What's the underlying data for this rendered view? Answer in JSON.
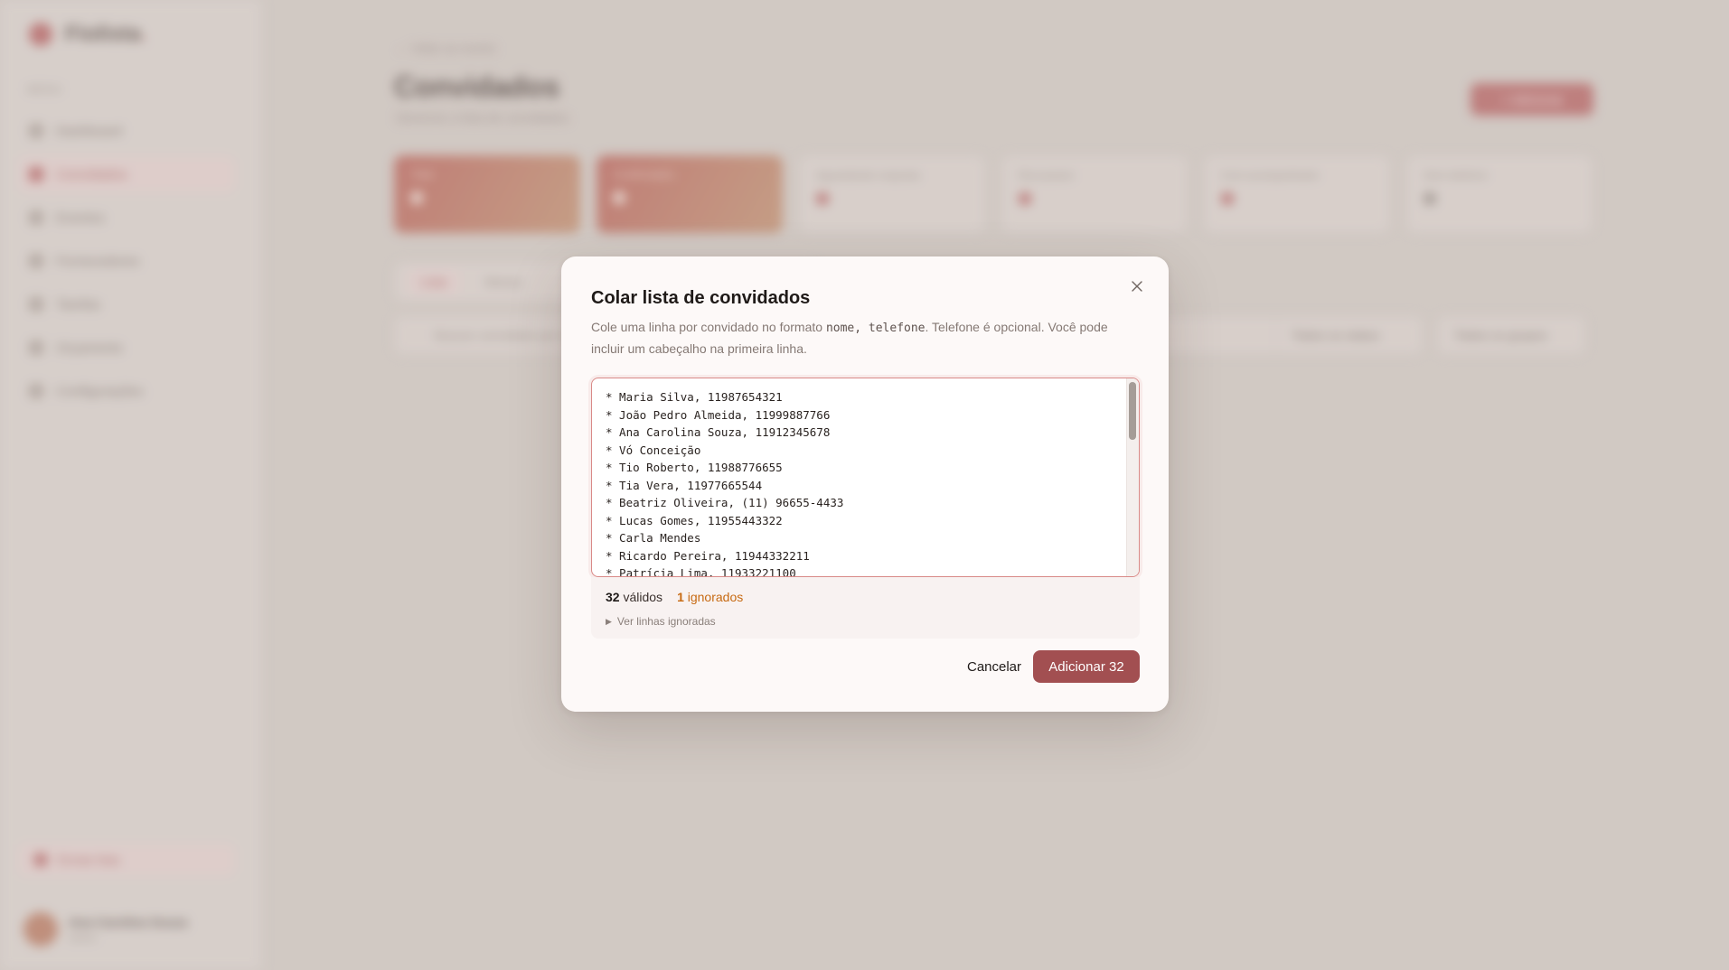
{
  "sidebar": {
    "brand": "Fiolista",
    "section_label": "MENU",
    "items": [
      {
        "label": "Dashboard"
      },
      {
        "label": "Convidados"
      },
      {
        "label": "Eventos"
      },
      {
        "label": "Fornecedores"
      },
      {
        "label": "Tarefas"
      },
      {
        "label": "Orçamento"
      },
      {
        "label": "Configurações"
      }
    ],
    "cta": "Enviar lista",
    "profile": {
      "name": "Ana Carolina Souza",
      "role": "Admin"
    }
  },
  "page": {
    "back": "← Voltar ao evento",
    "title": "Convidados",
    "subtitle": "Gerencie a lista de convidados",
    "primary_action": "+ Adicionar",
    "stats": [
      {
        "label": "Total"
      },
      {
        "label": "Confirmados"
      },
      {
        "label": "Aguardando resposta"
      },
      {
        "label": "Recusaram"
      },
      {
        "label": "Com acompanhante"
      },
      {
        "label": "Sem telefone"
      }
    ],
    "tabs": [
      {
        "label": "Lista"
      },
      {
        "label": "Mesas"
      }
    ],
    "search_placeholder": "Buscar convidado por nome",
    "filters": [
      {
        "label": "Todos os status"
      },
      {
        "label": "Todos os grupos"
      }
    ]
  },
  "modal": {
    "title": "Colar lista de convidados",
    "description_before": "Cole uma linha por convidado no formato ",
    "description_code": "nome, telefone",
    "description_after": ". Telefone é opcional. Você pode incluir um cabeçalho na primeira linha.",
    "lines": [
      "* Maria Silva, 11987654321",
      "* João Pedro Almeida, 11999887766",
      "* Ana Carolina Souza, 11912345678",
      "* Vó Conceição",
      "* Tio Roberto, 11988776655",
      "* Tia Vera, 11977665544",
      "* Beatriz Oliveira, (11) 96655-4433",
      "* Lucas Gomes, 11955443322",
      "* Carla Mendes",
      "* Ricardo Pereira, 11944332211",
      "* Patrícia Lima, 11933221100"
    ],
    "valid_count": "32",
    "valid_label": "válidos",
    "ignored_count": "1",
    "ignored_label": "ignorados",
    "toggle_label": "Ver linhas ignoradas",
    "cancel_label": "Cancelar",
    "submit_label": "Adicionar 32"
  },
  "colors": {
    "accent": "#a24f51",
    "warning": "#c76a12",
    "focus_border": "#d98a88"
  }
}
